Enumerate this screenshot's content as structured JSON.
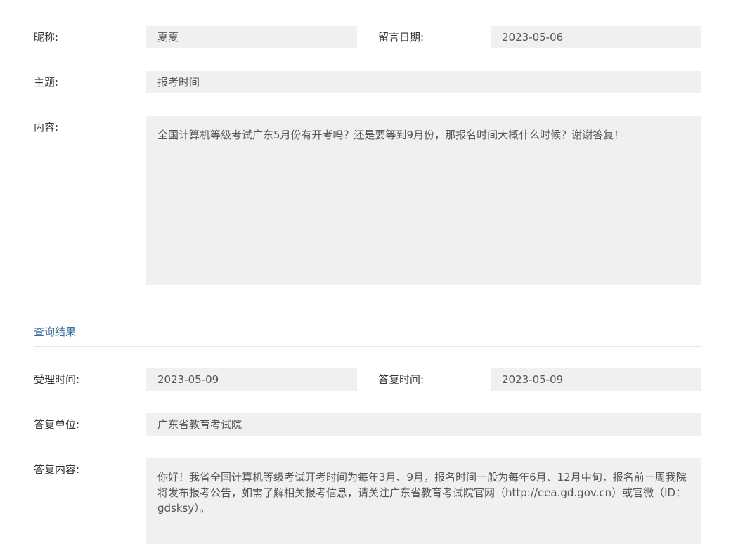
{
  "message": {
    "nickname_label": "昵称:",
    "nickname_value": "夏夏",
    "date_label": "留言日期:",
    "date_value": "2023-05-06",
    "subject_label": "主题:",
    "subject_value": "报考时间",
    "content_label": "内容:",
    "content_value": "全国计算机等级考试广东5月份有开考吗？还是要等到9月份，那报名时间大概什么时候？谢谢答复！"
  },
  "result": {
    "section_title": "查询结果",
    "accept_time_label": "受理时间:",
    "accept_time_value": "2023-05-09",
    "reply_time_label": "答复时间:",
    "reply_time_value": "2023-05-09",
    "reply_unit_label": "答复单位:",
    "reply_unit_value": "广东省教育考试院",
    "reply_content_label": "答复内容:",
    "reply_content_value": "你好！我省全国计算机等级考试开考时间为每年3月、9月，报名时间一般为每年6月、12月中旬，报名前一周我院将发布报考公告，如需了解相关报考信息，请关注广东省教育考试院官网（http://eea.gd.gov.cn）或官微（ID：gdsksy）。"
  },
  "colors": {
    "field_bg": "#f0f0f0",
    "section_title": "#3a6ea5",
    "divider": "#e6e6e6"
  }
}
